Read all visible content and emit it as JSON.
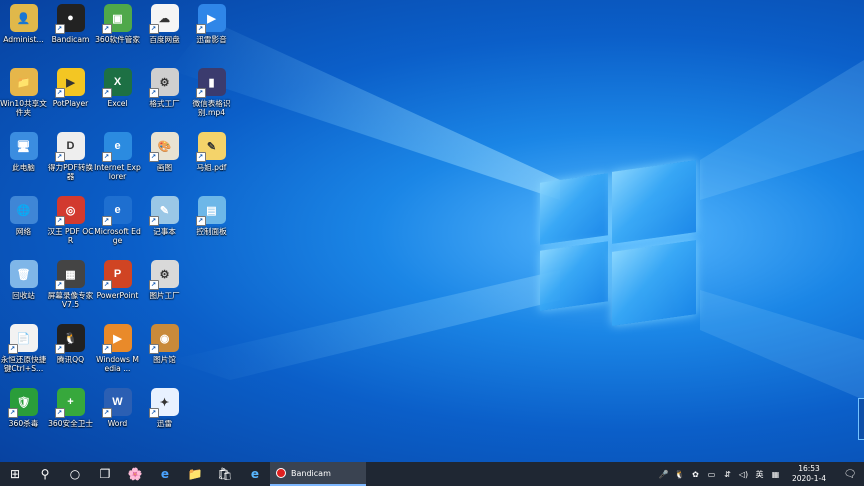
{
  "desktop": {
    "icons": [
      {
        "name": "administrator-icon",
        "label": "Administ...",
        "color": "#e0b84a",
        "glyph": "👤"
      },
      {
        "name": "win10-share-icon",
        "label": "Win10共享文件夹",
        "color": "#e6b64a",
        "glyph": "📁"
      },
      {
        "name": "this-pc-icon",
        "label": "此电脑",
        "color": "#3b8de0",
        "glyph": "🖥"
      },
      {
        "name": "network-icon",
        "label": "网络",
        "color": "#3f86d6",
        "glyph": "🌐"
      },
      {
        "name": "recycle-bin-icon",
        "label": "回收站",
        "color": "#7fb6e8",
        "glyph": "🗑"
      },
      {
        "name": "text-file-icon",
        "label": "永恒还原快捷键Ctrl+S...",
        "color": "#f2f2f2",
        "glyph": "📄"
      },
      {
        "name": "360-antivirus-icon",
        "label": "360杀毒",
        "color": "#2a9d3a",
        "glyph": "🛡"
      },
      {
        "name": "bandicam-icon",
        "label": "Bandicam",
        "color": "#222222",
        "glyph": "●"
      },
      {
        "name": "potplayer-icon",
        "label": "PotPlayer",
        "color": "#f3c623",
        "glyph": "▶"
      },
      {
        "name": "pdf-converter-icon",
        "label": "得力PDF转换器",
        "color": "#eeeeee",
        "glyph": "D"
      },
      {
        "name": "hanwang-ocr-icon",
        "label": "汉王 PDF OCR",
        "color": "#d23a2f",
        "glyph": "◎"
      },
      {
        "name": "screen-recorder-icon",
        "label": "屏幕录像专家V7.5",
        "color": "#444444",
        "glyph": "▦"
      },
      {
        "name": "tencent-qq-icon",
        "label": "腾讯QQ",
        "color": "#222222",
        "glyph": "🐧"
      },
      {
        "name": "360-security-icon",
        "label": "360安全卫士",
        "color": "#37a83c",
        "glyph": "+"
      },
      {
        "name": "360-manager-icon",
        "label": "360软件管家",
        "color": "#4fa84a",
        "glyph": "▣"
      },
      {
        "name": "excel-icon",
        "label": "Excel",
        "color": "#1d7044",
        "glyph": "X"
      },
      {
        "name": "internet-explorer-icon",
        "label": "Internet Explorer",
        "color": "#2b8be0",
        "glyph": "e"
      },
      {
        "name": "microsoft-edge-icon",
        "label": "Microsoft Edge",
        "color": "#1e6fd0",
        "glyph": "e"
      },
      {
        "name": "powerpoint-icon",
        "label": "PowerPoint",
        "color": "#d04423",
        "glyph": "P"
      },
      {
        "name": "windows-media-icon",
        "label": "Windows Media ...",
        "color": "#e98a2a",
        "glyph": "▶"
      },
      {
        "name": "word-icon",
        "label": "Word",
        "color": "#2b5fb3",
        "glyph": "W"
      },
      {
        "name": "baidu-netdisk-icon",
        "label": "百度网盘",
        "color": "#f5f5f5",
        "glyph": "☁"
      },
      {
        "name": "format-factory-icon",
        "label": "格式工厂",
        "color": "#cfcfcf",
        "glyph": "⚙"
      },
      {
        "name": "paint-icon",
        "label": "画图",
        "color": "#e9e3d2",
        "glyph": "🎨"
      },
      {
        "name": "notepad-icon",
        "label": "记事本",
        "color": "#9ac7e6",
        "glyph": "✎"
      },
      {
        "name": "image-factory-icon",
        "label": "图片工厂",
        "color": "#d9d9d9",
        "glyph": "⚙"
      },
      {
        "name": "image-viewer-icon",
        "label": "图片馆",
        "color": "#c98a3a",
        "glyph": "◉"
      },
      {
        "name": "thunder-icon",
        "label": "迅雷",
        "color": "#e8f1ff",
        "glyph": "✦"
      },
      {
        "name": "xunlei-video-icon",
        "label": "迅雷影音",
        "color": "#2f86e8",
        "glyph": "▶"
      },
      {
        "name": "video-file-icon",
        "label": "微信表格识别.mp4",
        "color": "#3b3b6e",
        "glyph": "▮"
      },
      {
        "name": "pdf-file-icon",
        "label": "马姐.pdf",
        "color": "#f4d36a",
        "glyph": "✎"
      },
      {
        "name": "control-panel-icon",
        "label": "控制面板",
        "color": "#6db7e8",
        "glyph": "▤"
      }
    ]
  },
  "taskbar": {
    "start_glyph": "⊞",
    "search_glyph": "⚲",
    "cortana_glyph": "○",
    "taskview_glyph": "❐",
    "pinned": [
      "🌸",
      "e",
      "📁",
      "🛍",
      "e"
    ],
    "active_app": "Bandicam",
    "tray": {
      "icons": [
        "🎤",
        "🐧",
        "✿",
        "▭",
        "⇵",
        "◁)"
      ],
      "ime": "英",
      "keyboard": "▦",
      "time": "16:53",
      "date": "2020-1-4",
      "notification_glyph": "🗨"
    }
  },
  "colors": {
    "taskbar": "#1f2733",
    "desktop_accent": "#1b86e6"
  }
}
